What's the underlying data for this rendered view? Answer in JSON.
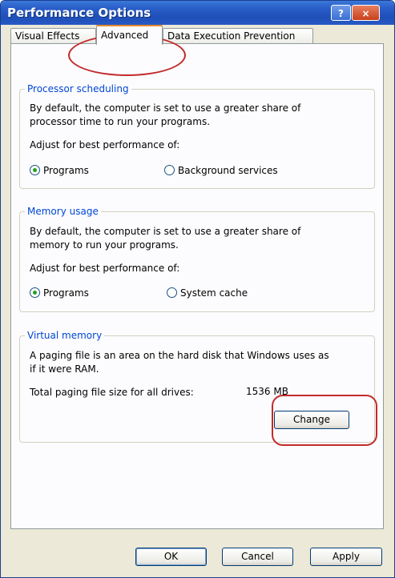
{
  "window": {
    "title": "Performance Options"
  },
  "title_buttons": {
    "help": "?",
    "close": "×"
  },
  "tabs": [
    {
      "label": "Visual Effects"
    },
    {
      "label": "Advanced"
    },
    {
      "label": "Data Execution Prevention"
    }
  ],
  "processor_scheduling": {
    "title": "Processor scheduling",
    "description_line1": "By default, the computer is set to use a greater share of",
    "description_line2": "processor time to run your programs.",
    "adjust_label": "Adjust for best performance of:",
    "options": [
      {
        "label": "Programs",
        "checked": true
      },
      {
        "label": "Background services",
        "checked": false
      }
    ]
  },
  "memory_usage": {
    "title": "Memory usage",
    "description_line1": "By default, the computer is set to use a greater share of",
    "description_line2": "memory to run your programs.",
    "adjust_label": "Adjust for best performance of:",
    "options": [
      {
        "label": "Programs",
        "checked": true
      },
      {
        "label": "System cache",
        "checked": false
      }
    ]
  },
  "virtual_memory": {
    "title": "Virtual memory",
    "description_line1": "A paging file is an area on the hard disk that Windows uses as",
    "description_line2": "if it were RAM.",
    "total_label": "Total paging file size for all drives:",
    "total_value": "1536 MB",
    "change_button": "Change"
  },
  "footer": {
    "ok": "OK",
    "cancel": "Cancel",
    "apply": "Apply"
  },
  "colors": {
    "titlebar": "#2a5ec9",
    "group_title": "#0046d5",
    "annotation": "#c22a2a"
  }
}
